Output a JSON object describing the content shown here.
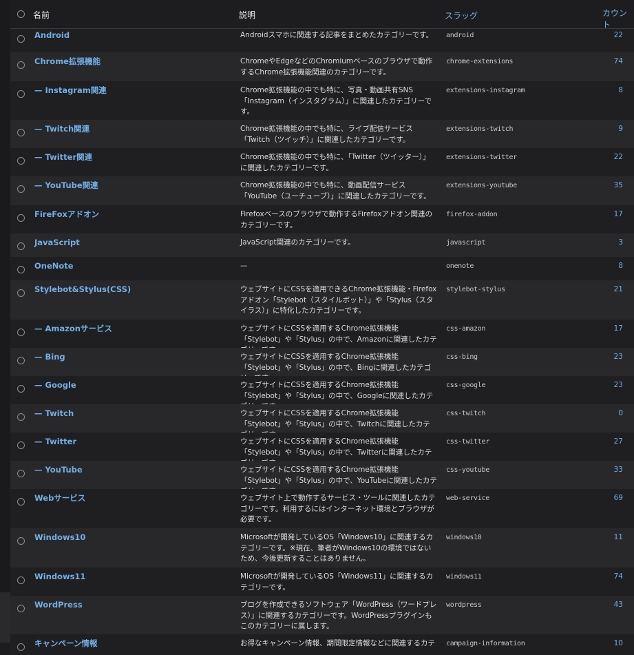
{
  "header": {
    "name": "名前",
    "description": "説明",
    "slug": "スラッグ",
    "count": "カウント"
  },
  "rows": [
    {
      "name": "Android",
      "description": "Androidスマホに関連する記事をまとめたカテゴリーです。",
      "slug": "android",
      "count": "22"
    },
    {
      "name": "Chrome拡張機能",
      "description": "ChromeやEdgeなどのChromiumベースのブラウザで動作するChrome拡張機能関連のカテゴリーです。",
      "slug": "chrome-extensions",
      "count": "74"
    },
    {
      "name": "— Instagram関連",
      "description": "Chrome拡張機能の中でも特に、写真・動画共有SNS「Instagram（インスタグラム）」に関連したカテゴリーです。",
      "slug": "extensions-instagram",
      "count": "8"
    },
    {
      "name": "— Twitch関連",
      "description": "Chrome拡張機能の中でも特に、ライブ配信サービス「Twitch（ツイッチ）」に関連したカテゴリーです。",
      "slug": "extensions-twitch",
      "count": "9"
    },
    {
      "name": "— Twitter関連",
      "description": "Chrome拡張機能の中でも特に、「Twitter（ツイッター）」に関連したカテゴリーです。",
      "slug": "extensions-twitter",
      "count": "22"
    },
    {
      "name": "— YouTube関連",
      "description": "Chrome拡張機能の中でも特に、動画配信サービス「YouTube（ユーチューブ）」に関連したカテゴリーです。",
      "slug": "extensions-youtube",
      "count": "35"
    },
    {
      "name": "FireFoxアドオン",
      "description": "Firefoxベースのブラウザで動作するFirefoxアドオン関連のカテゴリーです。",
      "slug": "firefox-addon",
      "count": "17"
    },
    {
      "name": "JavaScript",
      "description": "JavaScript関連のカテゴリーです。",
      "slug": "javascript",
      "count": "3"
    },
    {
      "name": "OneNote",
      "description": "—",
      "slug": "onenote",
      "count": "8"
    },
    {
      "name": "Stylebot&Stylus(CSS)",
      "description": "ウェブサイトにCSSを適用できるChrome拡張機能・Firefoxアドオン「Stylebot（スタイルボット）」や「Stylus（スタイラス）」に特化したカテゴリーです。",
      "slug": "stylebot-stylus",
      "count": "21"
    },
    {
      "name": "— Amazonサービス",
      "description": "ウェブサイトにCSSを適用するChrome拡張機能「Stylebot」や「Stylus」の中で、Amazonに関連したカテゴリーです。",
      "slug": "css-amazon",
      "count": "17"
    },
    {
      "name": "— Bing",
      "description": "ウェブサイトにCSSを適用するChrome拡張機能「Stylebot」や「Stylus」の中で、Bingに関連したカテゴリーです。",
      "slug": "css-bing",
      "count": "23"
    },
    {
      "name": "— Google",
      "description": "ウェブサイトにCSSを適用するChrome拡張機能「Stylebot」や「Stylus」の中で、Googleに関連したカテゴリーです。",
      "slug": "css-google",
      "count": "23"
    },
    {
      "name": "— Twitch",
      "description": "ウェブサイトにCSSを適用するChrome拡張機能「Stylebot」や「Stylus」の中で、Twitchに関連したカテゴリーです。",
      "slug": "css-twitch",
      "count": "0"
    },
    {
      "name": "— Twitter",
      "description": "ウェブサイトにCSSを適用するChrome拡張機能「Stylebot」や「Stylus」の中で、Twitterに関連したカテゴリーです。",
      "slug": "css-twitter",
      "count": "27"
    },
    {
      "name": "— YouTube",
      "description": "ウェブサイトにCSSを適用するChrome拡張機能「Stylebot」や「Stylus」の中で、YouTubeに関連したカテゴリーです。",
      "slug": "css-youtube",
      "count": "33"
    },
    {
      "name": "Webサービス",
      "description": "ウェブサイト上で動作するサービス・ツールに関連したカテゴリーです。利用するにはインターネット環境とブラウザが必要です。",
      "slug": "web-service",
      "count": "69"
    },
    {
      "name": "Windows10",
      "description": "Microsoftが開発しているOS「Windows10」に関連するカテゴリーです。※現在、筆者がWindows10の環境ではないため、今後更新することはありません。",
      "slug": "windows10",
      "count": "11"
    },
    {
      "name": "Windows11",
      "description": "Microsoftが開発しているOS「Windows11」に関連するカテゴリーです。",
      "slug": "windows11",
      "count": "74"
    },
    {
      "name": "WordPress",
      "description": "ブログを作成できるソフトウェア「WordPress（ワードプレス）」に関連するカテゴリーです。WordPressプラグインもこのカテゴリーに属します。",
      "slug": "wordpress",
      "count": "43"
    },
    {
      "name": "キャンペーン情報",
      "description": "お得なキャンペーン情報、期間限定情報などに関連するカテ",
      "slug": "campaign-information",
      "count": "10"
    }
  ]
}
